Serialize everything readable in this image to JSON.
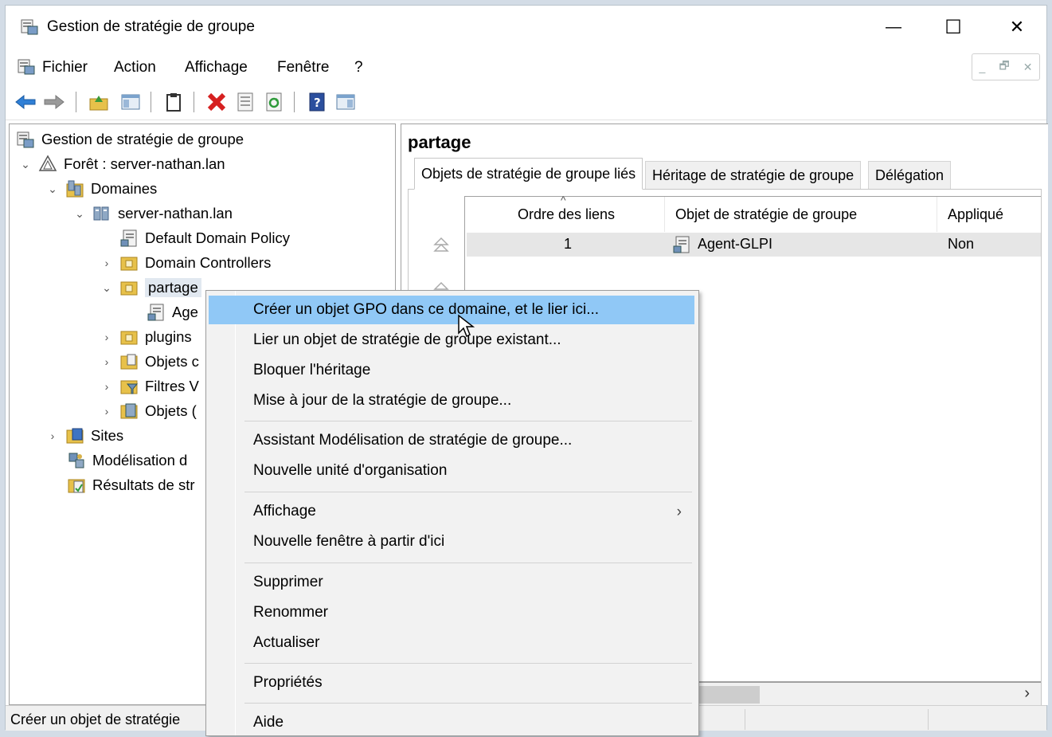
{
  "window": {
    "title": "Gestion de stratégie de groupe",
    "min_symbol": "—",
    "max_symbol": "☐",
    "close_symbol": "✕"
  },
  "menu": [
    "Fichier",
    "Action",
    "Affichage",
    "Fenêtre",
    "?"
  ],
  "mdi_controls": [
    "_",
    "🗗",
    "✕"
  ],
  "toolbar": {
    "icons": [
      "back-arrow-icon",
      "forward-arrow-icon",
      "up-folder-icon",
      "show-hide-tree-icon",
      "clipboard-icon",
      "delete-icon",
      "properties-icon",
      "refresh-icon",
      "help-icon",
      "action-pane-icon"
    ]
  },
  "tree": {
    "root": "Gestion de stratégie de groupe",
    "forest": "Forêt : server-nathan.lan",
    "domains": "Domaines",
    "domain": "server-nathan.lan",
    "default_policy": "Default Domain Policy",
    "domain_controllers": "Domain Controllers",
    "partage": "partage",
    "agent": "Age",
    "plugins": "plugins",
    "objets1": "Objets c",
    "filtres": "Filtres V",
    "objets2": "Objets (",
    "sites": "Sites",
    "modelisation": "Modélisation d",
    "resultats": "Résultats de str"
  },
  "detail": {
    "title": "partage",
    "tabs": [
      "Objets de stratégie de groupe liés",
      "Héritage de stratégie de groupe",
      "Délégation"
    ],
    "columns": [
      "Ordre des liens",
      "Objet de stratégie de groupe",
      "Appliqué"
    ],
    "sort_indicator": "^",
    "rows": [
      {
        "order": "1",
        "gpo": "Agent-GLPI",
        "applied": "Non"
      }
    ],
    "scroll_right": "›"
  },
  "context_menu": {
    "items": [
      "Créer un objet GPO dans ce domaine, et le lier ici...",
      "Lier un objet de stratégie de groupe existant...",
      "Bloquer l'héritage",
      "Mise à jour de la stratégie de groupe...",
      "Assistant Modélisation de stratégie de groupe...",
      "Nouvelle unité d'organisation",
      "Affichage",
      "Nouvelle fenêtre à partir d'ici",
      "Supprimer",
      "Renommer",
      "Actualiser",
      "Propriétés",
      "Aide"
    ],
    "submenu_arrow": "›",
    "highlighted_index": 0
  },
  "status": {
    "text": "Créer un objet de stratégie"
  },
  "colors": {
    "highlight": "#90c8f6",
    "selection": "#e1e8f0",
    "menu_bg": "#f2f2f2",
    "delete_red": "#d62020",
    "arrow_blue": "#2f7fd6"
  }
}
